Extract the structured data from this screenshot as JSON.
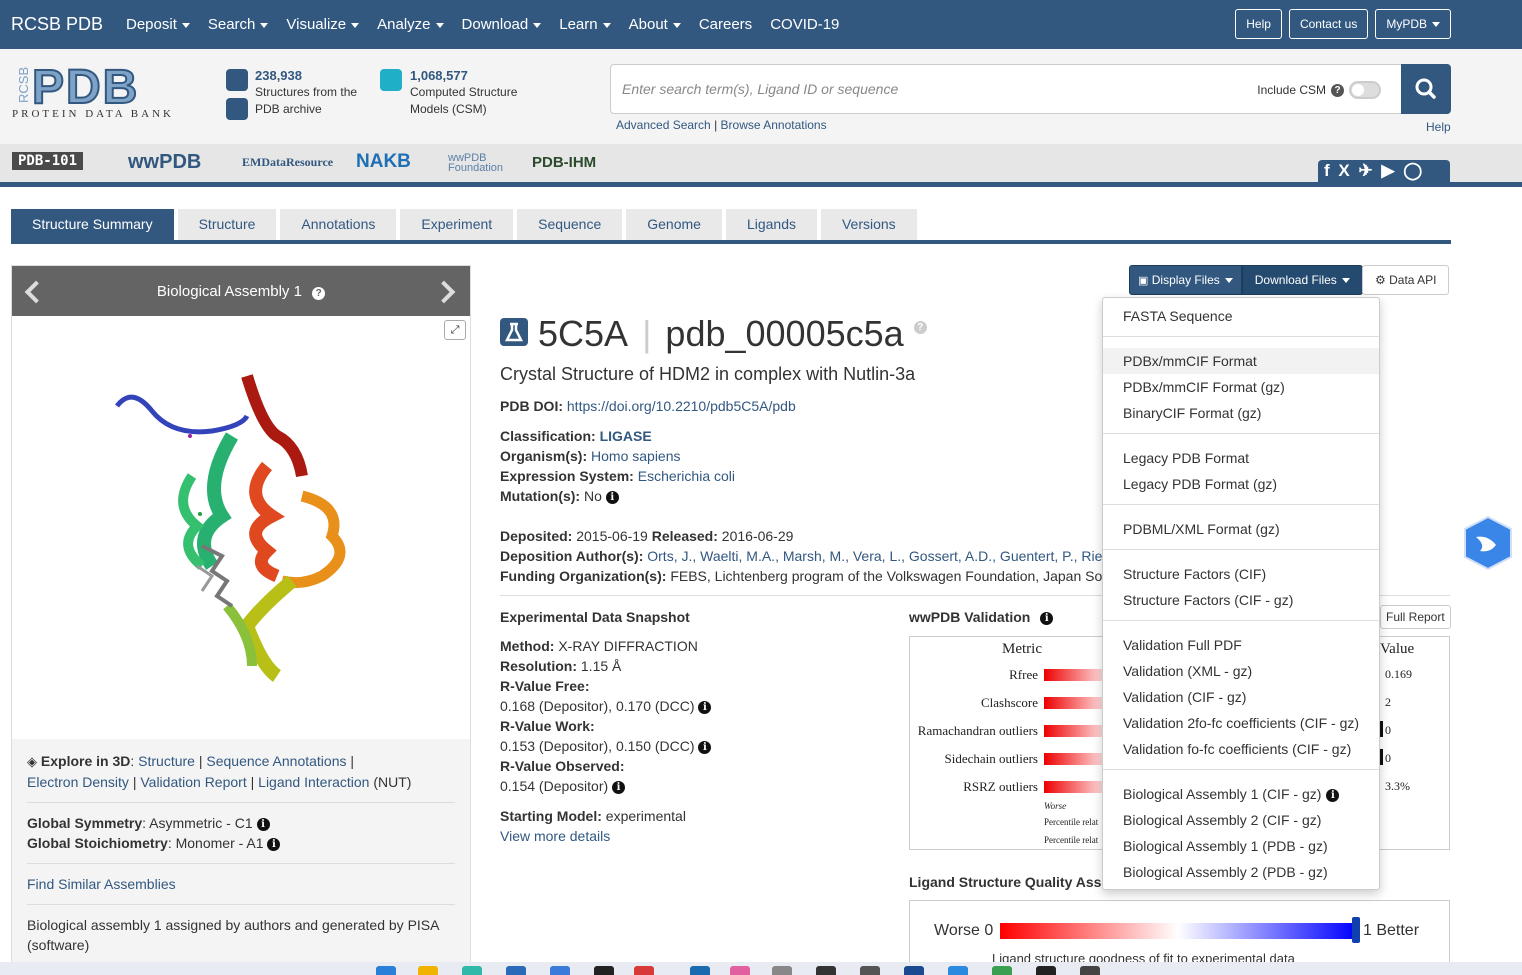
{
  "navbar": {
    "brand": "RCSB PDB",
    "items": [
      "Deposit",
      "Search",
      "Visualize",
      "Analyze",
      "Download",
      "Learn",
      "About",
      "Careers",
      "COVID-19"
    ],
    "dropdown_flags": [
      true,
      true,
      true,
      true,
      true,
      true,
      true,
      false,
      false
    ],
    "right": {
      "help": "Help",
      "contact": "Contact us",
      "mypdb": "MyPDB"
    }
  },
  "header": {
    "logo_text": "PROTEIN DATA BANK",
    "logo_mark": "PDB",
    "logo_side": "RCSB",
    "stats": [
      {
        "num": "238,938",
        "line1": "Structures from the",
        "line2": "PDB archive"
      },
      {
        "num": "1,068,577",
        "line1": "Computed Structure",
        "line2": "Models (CSM)"
      }
    ],
    "search_placeholder": "Enter search term(s), Ligand ID or sequence",
    "include_csm": "Include CSM",
    "advanced_search": "Advanced Search",
    "browse_annotations": "Browse Annotations",
    "help": "Help"
  },
  "partners": [
    "PDB-101",
    "wwPDB",
    "EMDataResource",
    "NAKB",
    "wwPDB Foundation",
    "PDB-IHM"
  ],
  "social_icons": "f X ✈ ▶ ◯ in",
  "tabs": [
    "Structure Summary",
    "Structure",
    "Annotations",
    "Experiment",
    "Sequence",
    "Genome",
    "Ligands",
    "Versions"
  ],
  "assembly_panel": {
    "title": "Biological Assembly 1",
    "explore_label": "Explore in 3D",
    "explore_links": [
      "Structure",
      "Sequence Annotations",
      "Electron Density",
      "Validation Report",
      "Ligand Interaction"
    ],
    "ligand_code": "(NUT)",
    "global_symmetry_label": "Global Symmetry",
    "global_symmetry": "Asymmetric - C1",
    "global_stoich_label": "Global Stoichiometry",
    "global_stoich": "Monomer - A1",
    "find_similar": "Find Similar Assemblies",
    "assembly_note": "Biological assembly 1 assigned by authors and generated by PISA (software)"
  },
  "buttons": {
    "display_files": "Display Files",
    "download_files": "Download Files",
    "data_api": "Data API"
  },
  "entry": {
    "id": "5C5A",
    "pdb_id": "pdb_00005c5a",
    "title": "Crystal Structure of HDM2 in complex with Nutlin-3a",
    "doi_label": "PDB DOI:",
    "doi": "https://doi.org/10.2210/pdb5C5A/pdb",
    "classification_label": "Classification:",
    "classification": "LIGASE",
    "organism_label": "Organism(s):",
    "organism": "Homo sapiens",
    "expression_label": "Expression System:",
    "expression": "Escherichia coli",
    "mutation_label": "Mutation(s):",
    "mutation": "No",
    "deposited_label": "Deposited:",
    "deposited": "2015-06-19",
    "released_label": "Released:",
    "released": "2016-06-29",
    "authors_label": "Deposition Author(s):",
    "authors": "Orts, J., Waelti, M.A., Marsh, M., Vera, L., Gossert, A.D., Guentert, P., Rie",
    "funding_label": "Funding Organization(s):",
    "funding": "FEBS, Lichtenberg program of the Volkswagen Foundation, Japan So"
  },
  "snapshot": {
    "title": "Experimental Data Snapshot",
    "method_label": "Method:",
    "method": "X-RAY DIFFRACTION",
    "resolution_label": "Resolution:",
    "resolution": "1.15 Å",
    "rfree_label": "R-Value Free:",
    "rfree": "0.168 (Depositor), 0.170 (DCC)",
    "rwork_label": "R-Value Work:",
    "rwork": "0.153 (Depositor), 0.150 (DCC)",
    "robs_label": "R-Value Observed:",
    "robs": "0.154 (Depositor)",
    "model_label": "Starting Model:",
    "model": "experimental",
    "more": "View more details"
  },
  "validation": {
    "title": "wwPDB Validation",
    "full_report": "Full Report",
    "metric_header": "Metric",
    "value_header": "Value",
    "metrics": [
      "Rfree",
      "Clashscore",
      "Ramachandran outliers",
      "Sidechain outliers",
      "RSRZ outliers"
    ],
    "values": [
      "0.169",
      "2",
      "0",
      "0",
      "3.3%"
    ],
    "worse": "Worse",
    "legend1": "Percentile relat",
    "legend2": "Percentile relat"
  },
  "ligand_quality": {
    "title": "Ligand Structure Quality Asse",
    "worse": "Worse 0",
    "better": "1 Better",
    "caption": "Ligand structure goodness of fit to experimental data"
  },
  "download_menu": {
    "groups": [
      [
        "FASTA Sequence"
      ],
      [
        "PDBx/mmCIF Format",
        "PDBx/mmCIF Format (gz)",
        "BinaryCIF Format (gz)"
      ],
      [
        "Legacy PDB Format",
        "Legacy PDB Format (gz)"
      ],
      [
        "PDBML/XML Format (gz)"
      ],
      [
        "Structure Factors (CIF)",
        "Structure Factors (CIF - gz)"
      ],
      [
        "Validation Full PDF",
        "Validation (XML - gz)",
        "Validation (CIF - gz)",
        "Validation 2fo-fc coefficients (CIF - gz)",
        "Validation fo-fc coefficients (CIF - gz)"
      ],
      [
        "Biological Assembly 1 (CIF - gz)",
        "Biological Assembly 2 (CIF - gz)",
        "Biological Assembly 1 (PDB - gz)",
        "Biological Assembly 2 (PDB - gz)"
      ]
    ],
    "highlighted": "PDBx/mmCIF Format"
  },
  "colors": {
    "primary": "#325880",
    "accent": "#325880",
    "bg_header": "#f4f4f4"
  }
}
